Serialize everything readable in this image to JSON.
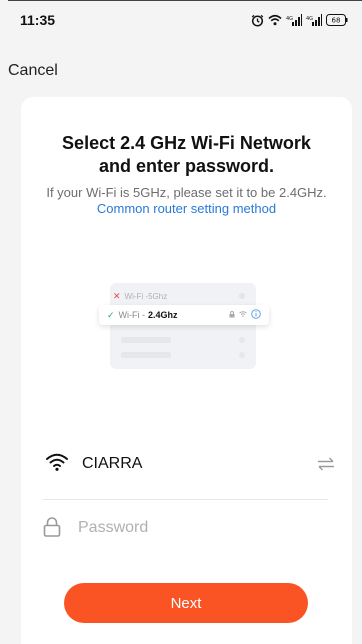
{
  "status_bar": {
    "time": "11:35",
    "battery": "68",
    "icons": [
      "alarm-icon",
      "wifi-icon",
      "signal-icon",
      "signal-icon",
      "battery-icon"
    ]
  },
  "nav": {
    "cancel_label": "Cancel"
  },
  "card": {
    "title": "Select 2.4 GHz Wi-Fi Network and enter password.",
    "subtitle": "If your Wi-Fi is 5GHz, please set it to be 2.4GHz.",
    "subtitle_link": "Common router setting method"
  },
  "illustration": {
    "row_5ghz_prefix": "Wi-Fi - ",
    "row_5ghz_band": "5Ghz",
    "row_24ghz_prefix": "Wi-Fi - ",
    "row_24ghz_band": "2.4Ghz"
  },
  "form": {
    "ssid": "CIARRA",
    "password_value": "",
    "password_placeholder": "Password",
    "next_label": "Next"
  },
  "colors": {
    "accent": "#fa5424",
    "link": "#2a79d8",
    "ok": "#27ae60",
    "error": "#e74c3c"
  }
}
